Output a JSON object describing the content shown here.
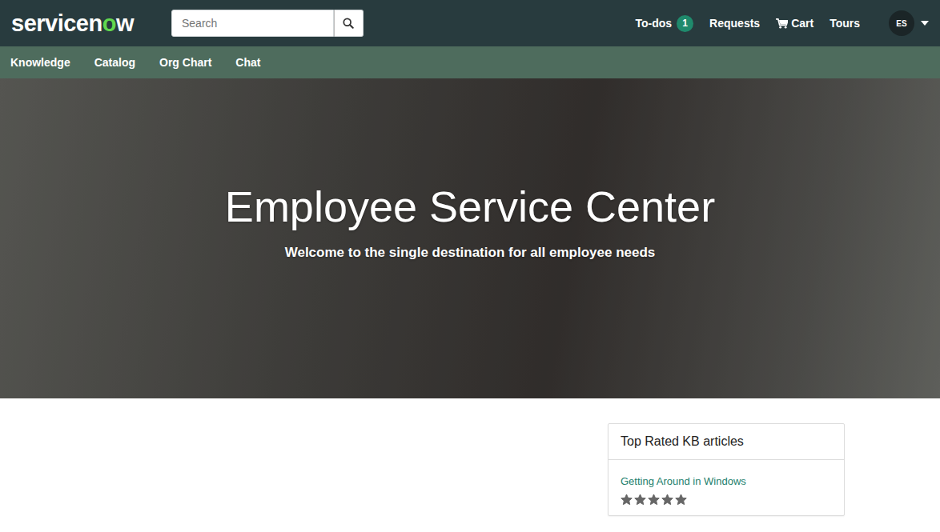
{
  "logo": {
    "parts": [
      {
        "text": "servicen",
        "color": "#ffffff"
      },
      {
        "text": "o",
        "color": "#62d84e"
      },
      {
        "text": "w",
        "color": "#ffffff"
      }
    ]
  },
  "search": {
    "placeholder": "Search"
  },
  "header": {
    "todos": {
      "label": "To-dos",
      "badge": "1"
    },
    "requests": "Requests",
    "cart": "Cart",
    "tours": "Tours",
    "user": {
      "initials": "ES"
    }
  },
  "menu": [
    "Knowledge",
    "Catalog",
    "Org Chart",
    "Chat"
  ],
  "hero": {
    "title": "Employee Service Center",
    "subtitle": "Welcome to the single destination for all employee needs"
  },
  "kb_card": {
    "title": "Top Rated KB articles",
    "articles": [
      {
        "title": "Getting Around in Windows",
        "stars": 5
      }
    ]
  }
}
